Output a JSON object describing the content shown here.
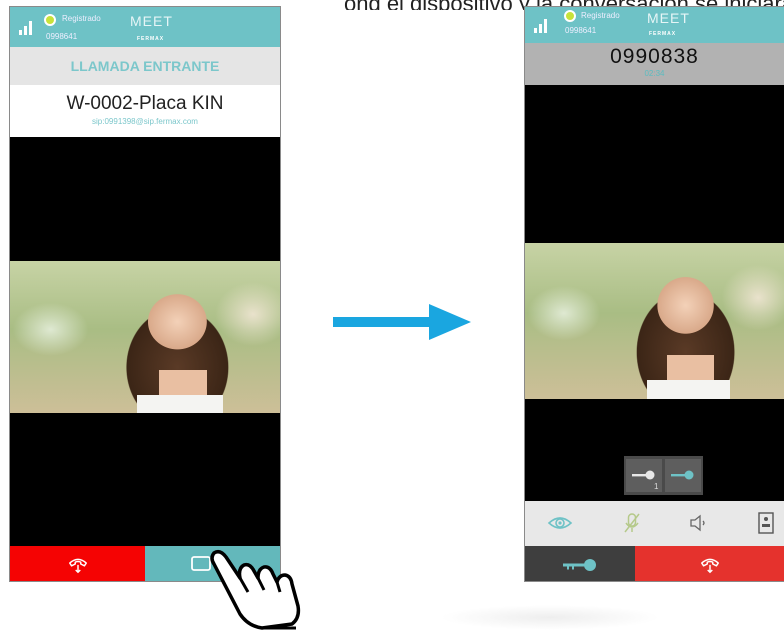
{
  "top_caption": "ong el dispositivo y la conversación se iniciará, la p",
  "incoming_phone": {
    "status": {
      "registered": "Registrado",
      "number": "0998641",
      "brand": "MEET",
      "maker": "FERMAX"
    },
    "header": "LLAMADA ENTRANTE",
    "caller_name": "W-0002-Placa KIN",
    "caller_sip": "sip:0991398@sip.fermax.com",
    "buttons": {
      "reject": "reject-call",
      "accept": "accept-call"
    }
  },
  "active_phone": {
    "status": {
      "registered": "Registrado",
      "number": "0998641",
      "brand": "MEET",
      "maker": "FERMAX"
    },
    "call_number": "0990838",
    "call_timer": "02:34",
    "key_index": "1",
    "controls": [
      "eye-icon",
      "mic-muted-icon",
      "speaker-icon",
      "intercom-icon"
    ],
    "actions": {
      "door": "door-key",
      "end": "end-call"
    }
  },
  "colors": {
    "teal": "#6ec2c6",
    "red": "#f50303",
    "end_red": "#e5322d",
    "arrow": "#1aa6e0"
  }
}
